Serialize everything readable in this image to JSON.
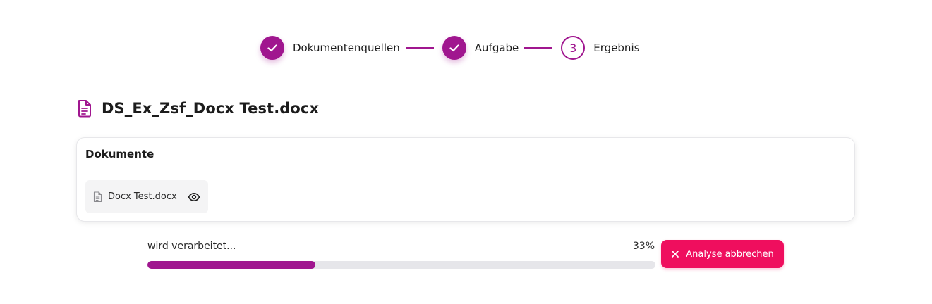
{
  "stepper": {
    "steps": [
      {
        "label": "Dokumentenquellen",
        "state": "done",
        "icon": "check-icon"
      },
      {
        "label": "Aufgabe",
        "state": "done",
        "icon": "check-icon"
      },
      {
        "label": "Ergebnis",
        "state": "current",
        "number": "3"
      }
    ]
  },
  "document": {
    "title": "DS_Ex_Zsf_Docx Test.docx",
    "icon": "document-icon"
  },
  "documents_card": {
    "title": "Dokumente",
    "files": [
      {
        "name": "Docx Test.docx",
        "icon": "file-icon",
        "action_icon": "eye-icon"
      }
    ]
  },
  "progress": {
    "status": "wird verarbeitet...",
    "percent_label": "33%",
    "value": 0.33
  },
  "cancel_button": {
    "label": "Analyse abbrechen",
    "icon": "close-icon"
  },
  "colors": {
    "accent": "#a0168f",
    "danger": "#ef0e5e",
    "track": "#e6e6ea"
  }
}
